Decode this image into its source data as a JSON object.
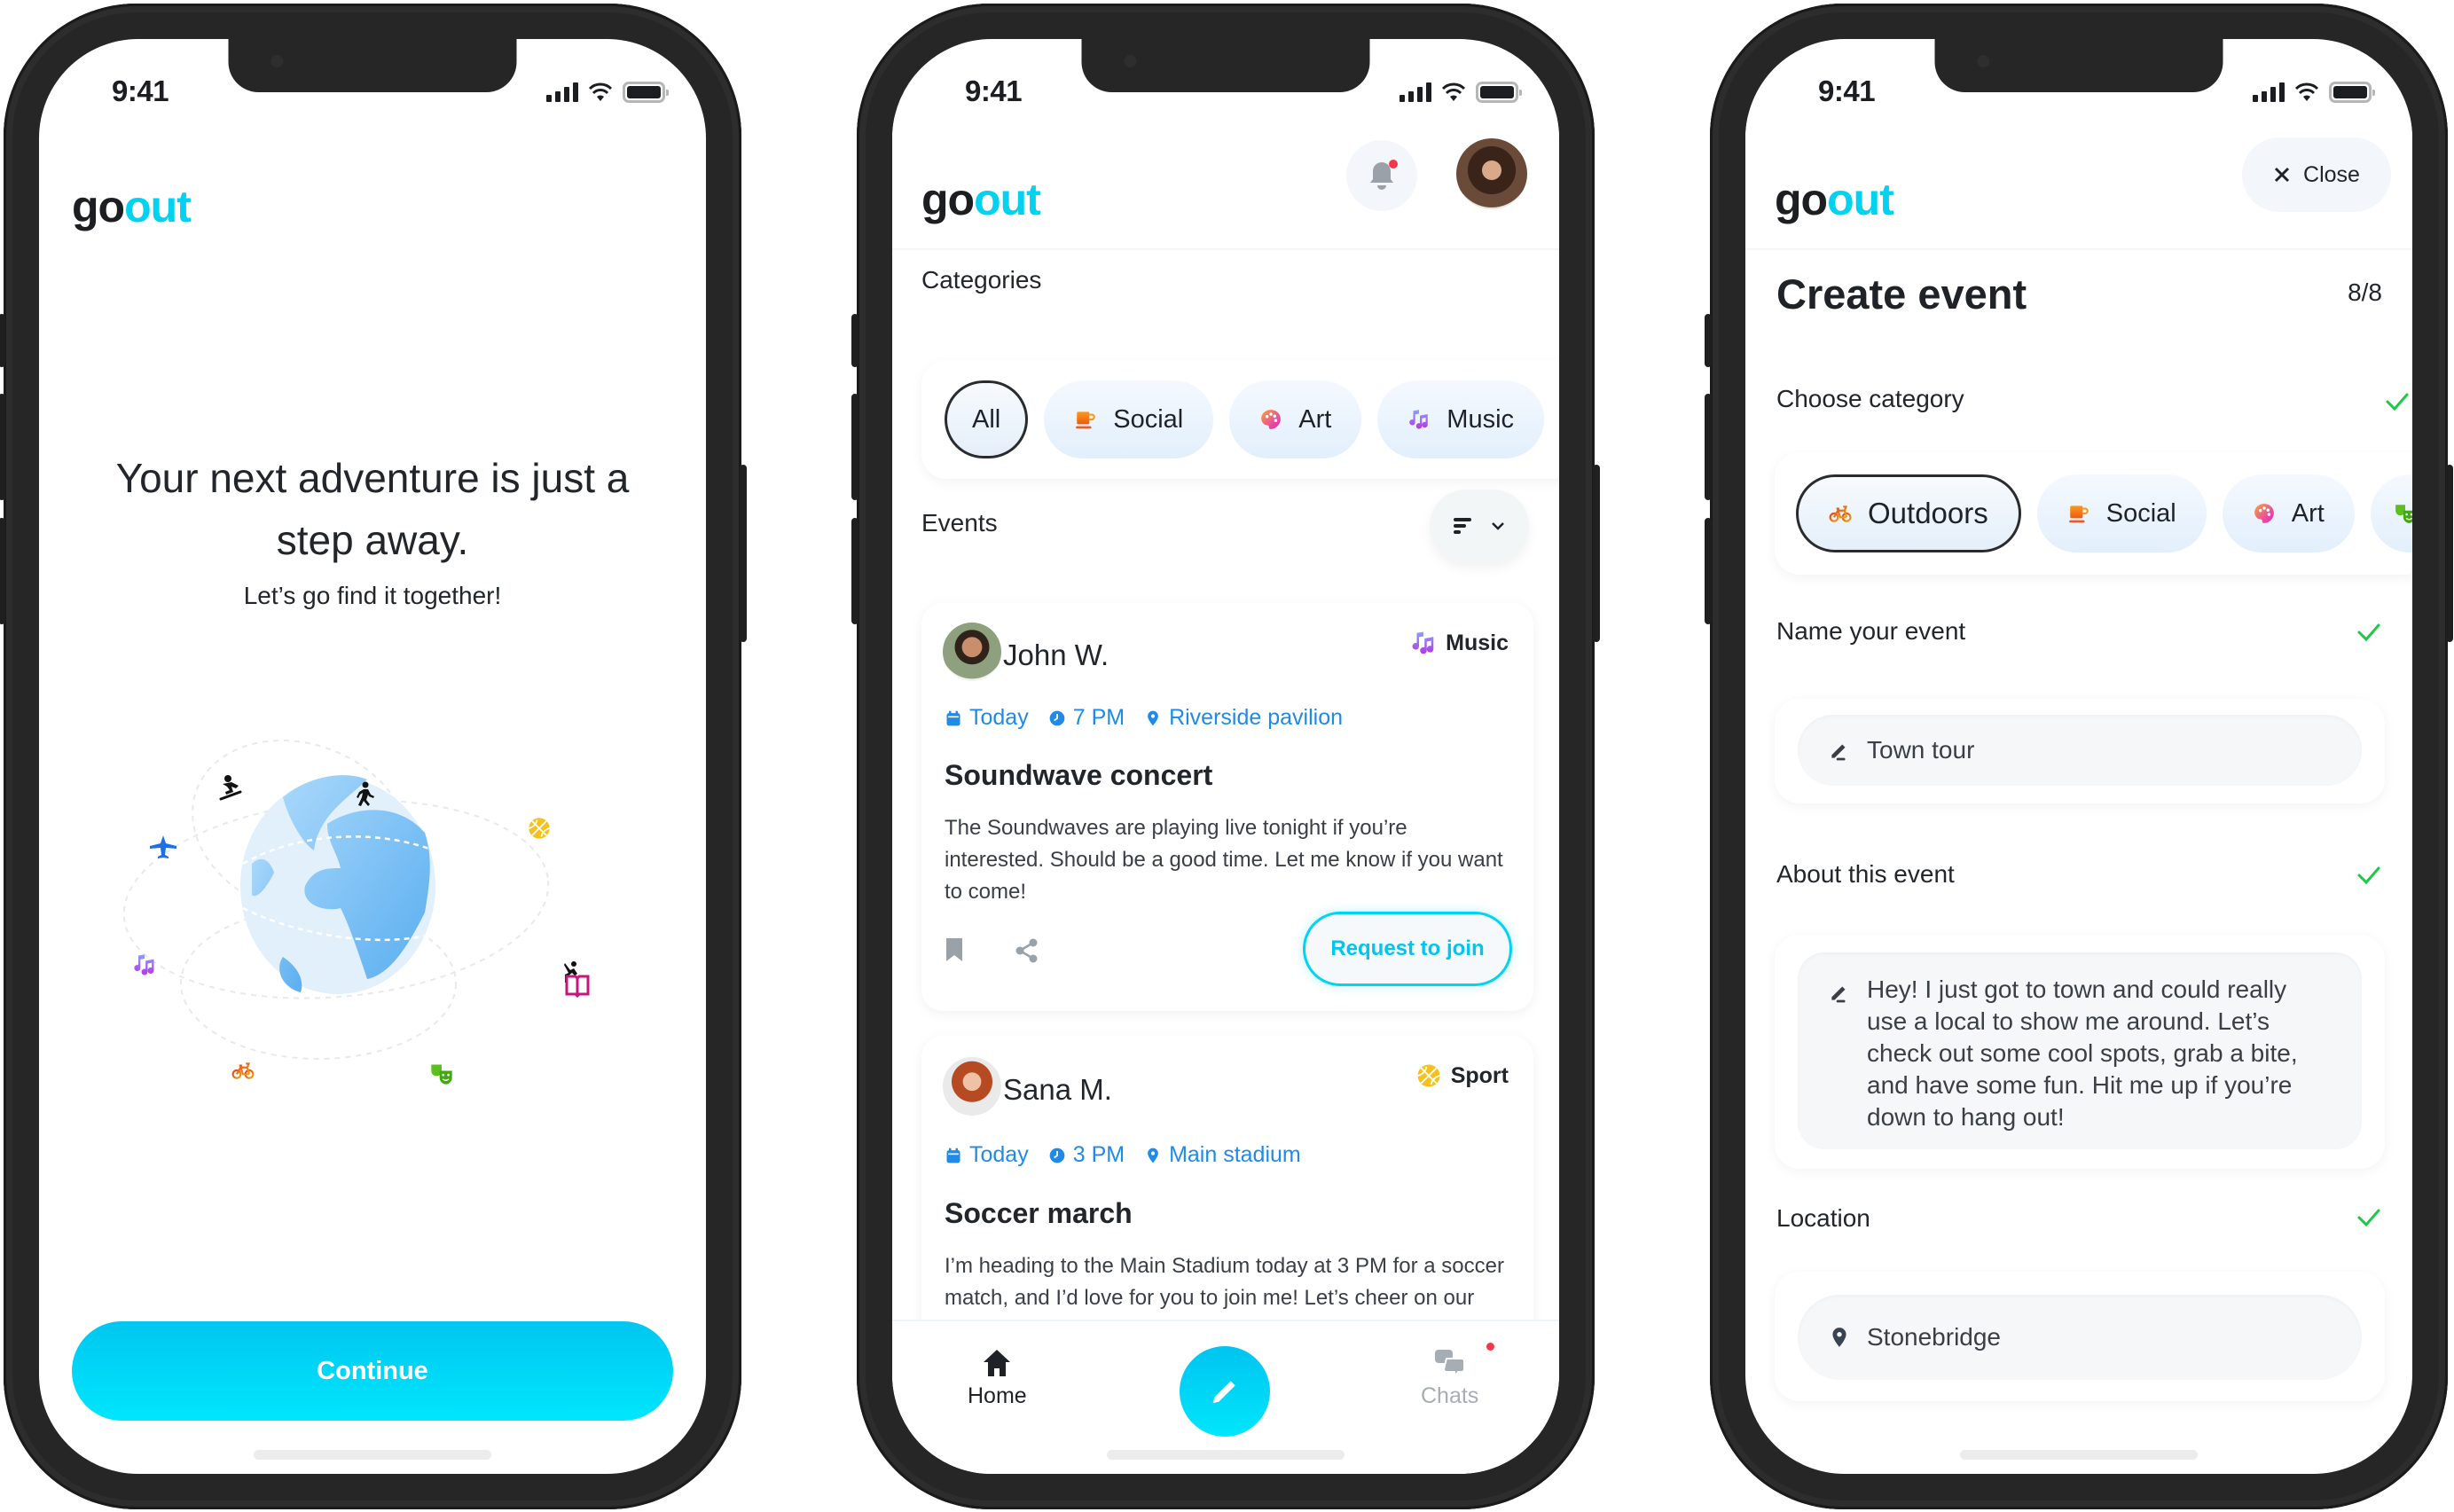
{
  "brand": {
    "logo_part1": "go",
    "logo_part2": "out",
    "accent": "#00d2f0"
  },
  "status_bar": {
    "time": "9:41"
  },
  "onboarding": {
    "headline": "Your next adventure is just a step away.",
    "subheadline": "Let’s go find it together!",
    "continue_label": "Continue",
    "illustration_icons": [
      "airplane-icon",
      "snowboarding-icon",
      "walking-icon",
      "basketball-icon",
      "music-icon",
      "climbing-icon",
      "book-icon",
      "bicycle-icon",
      "theater-masks-icon"
    ]
  },
  "home": {
    "categories_label": "Categories",
    "categories": [
      {
        "label": "All",
        "selected": true
      },
      {
        "label": "Social",
        "icon": "coffee-cup-icon"
      },
      {
        "label": "Art",
        "icon": "palette-icon"
      },
      {
        "label": "Music",
        "icon": "music-icon"
      }
    ],
    "events_label": "Events",
    "events": [
      {
        "user": "John W.",
        "category": "Music",
        "date": "Today",
        "time": "7 PM",
        "location": "Riverside pavilion",
        "title": "Soundwave concert",
        "description": "The Soundwaves are playing live tonight if you’re interested. Should be a good time. Let me know if you want to come!",
        "action": "Request to join"
      },
      {
        "user": "Sana M.",
        "category": "Sport",
        "date": "Today",
        "time": "3 PM",
        "location": "Main stadium",
        "title": "Soccer march",
        "description": "I’m heading to the Main Stadium today at 3 PM for a soccer match, and I’d love for you to join me! Let’s cheer on our team together!"
      }
    ],
    "tabbar": {
      "home": "Home",
      "chats": "Chats",
      "chats_has_unread": true
    },
    "notifications_unread": true
  },
  "create_event": {
    "close_label": "Close",
    "title": "Create event",
    "step": "8/8",
    "choose_category_label": "Choose category",
    "categories": [
      {
        "label": "Outdoors",
        "icon": "bicycle-icon",
        "selected": true
      },
      {
        "label": "Social",
        "icon": "coffee-cup-icon"
      },
      {
        "label": "Art",
        "icon": "palette-icon"
      },
      {
        "label": "",
        "icon": "theater-masks-icon"
      }
    ],
    "name_label": "Name your event",
    "name_value": "Town tour",
    "about_label": "About this event",
    "about_value": "Hey! I just got to town and could really use a local to show me around. Let’s check out some cool spots, grab a bite, and have some fun. Hit me up if you’re down to hang out!",
    "location_label": "Location",
    "location_value": "Stonebridge",
    "check_color": "#1fc84a"
  }
}
